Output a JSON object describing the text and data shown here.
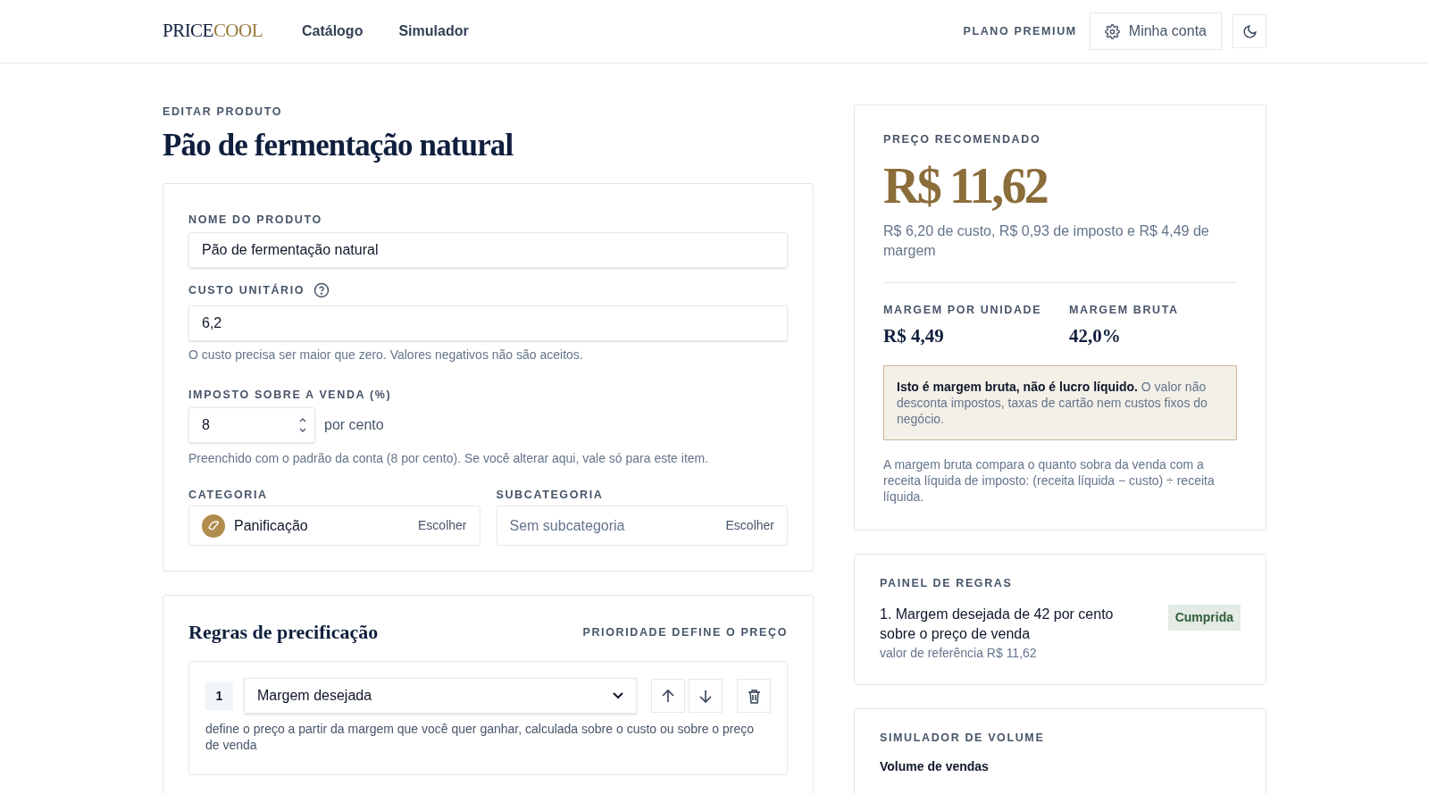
{
  "header": {
    "logo": {
      "part_1": "PRICE",
      "part_2": "COOL"
    },
    "nav": [
      {
        "label": "Catálogo"
      },
      {
        "label": "Simulador"
      }
    ],
    "plan": "PLANO PREMIUM",
    "account_button": "Minha conta"
  },
  "page": {
    "eyebrow": "EDITAR PRODUTO",
    "title": "Pão de fermentação natural"
  },
  "form": {
    "name_label": "NOME DO PRODUTO",
    "name_value": "Pão de fermentação natural",
    "cost_label": "CUSTO UNITÁRIO",
    "cost_value": "6,2",
    "cost_hint": "O custo precisa ser maior que zero. Valores negativos não são aceitos.",
    "tax_label": "IMPOSTO SOBRE A VENDA (%)",
    "tax_value": "8",
    "tax_unit": "por cento",
    "tax_hint": "Preenchido com o padrão da conta (8 por cento). Se você alterar aqui, vale só para este item.",
    "category_label": "CATEGORIA",
    "category_value": "Panificação",
    "category_action": "Escolher",
    "subcategory_label": "SUBCATEGORIA",
    "subcategory_value": "Sem subcategoria",
    "subcategory_action": "Escolher"
  },
  "rules": {
    "title": "Regras de precificação",
    "note": "PRIORIDADE DEFINE O PREÇO",
    "items": [
      {
        "number": "1",
        "type": "Margem desejada",
        "description": "define o preço a partir da margem que você quer ganhar, calculada sobre o custo ou sobre o preço de venda"
      }
    ]
  },
  "price_card": {
    "label": "PREÇO RECOMENDADO",
    "price": "R$ 11,62",
    "breakdown": "R$ 6,20 de custo, R$ 0,93 de imposto e R$ 4,49 de margem",
    "stats": [
      {
        "label": "MARGEM POR UNIDADE",
        "value": "R$ 4,49"
      },
      {
        "label": "MARGEM BRUTA",
        "value": "42,0%"
      }
    ],
    "warning": "**Isto é margem bruta, não é lucro líquido.** O valor não desconta impostos, taxas de cartão nem custos fixos do negócio.",
    "explanation": "A margem bruta compara o quanto sobra da venda com a receita líquida de imposto: (receita líquida − custo) ÷ receita líquida."
  },
  "rules_panel": {
    "title": "PAINEL DE REGRAS",
    "items": [
      {
        "text": "1. Margem desejada de 42 por cento sobre o preço de venda",
        "reference": "valor de referência R$ 11,62",
        "status": "Cumprida",
        "met": true
      }
    ]
  },
  "volume_simulator": {
    "title": "SIMULADOR DE VOLUME",
    "field_label": "Volume de vendas"
  }
}
